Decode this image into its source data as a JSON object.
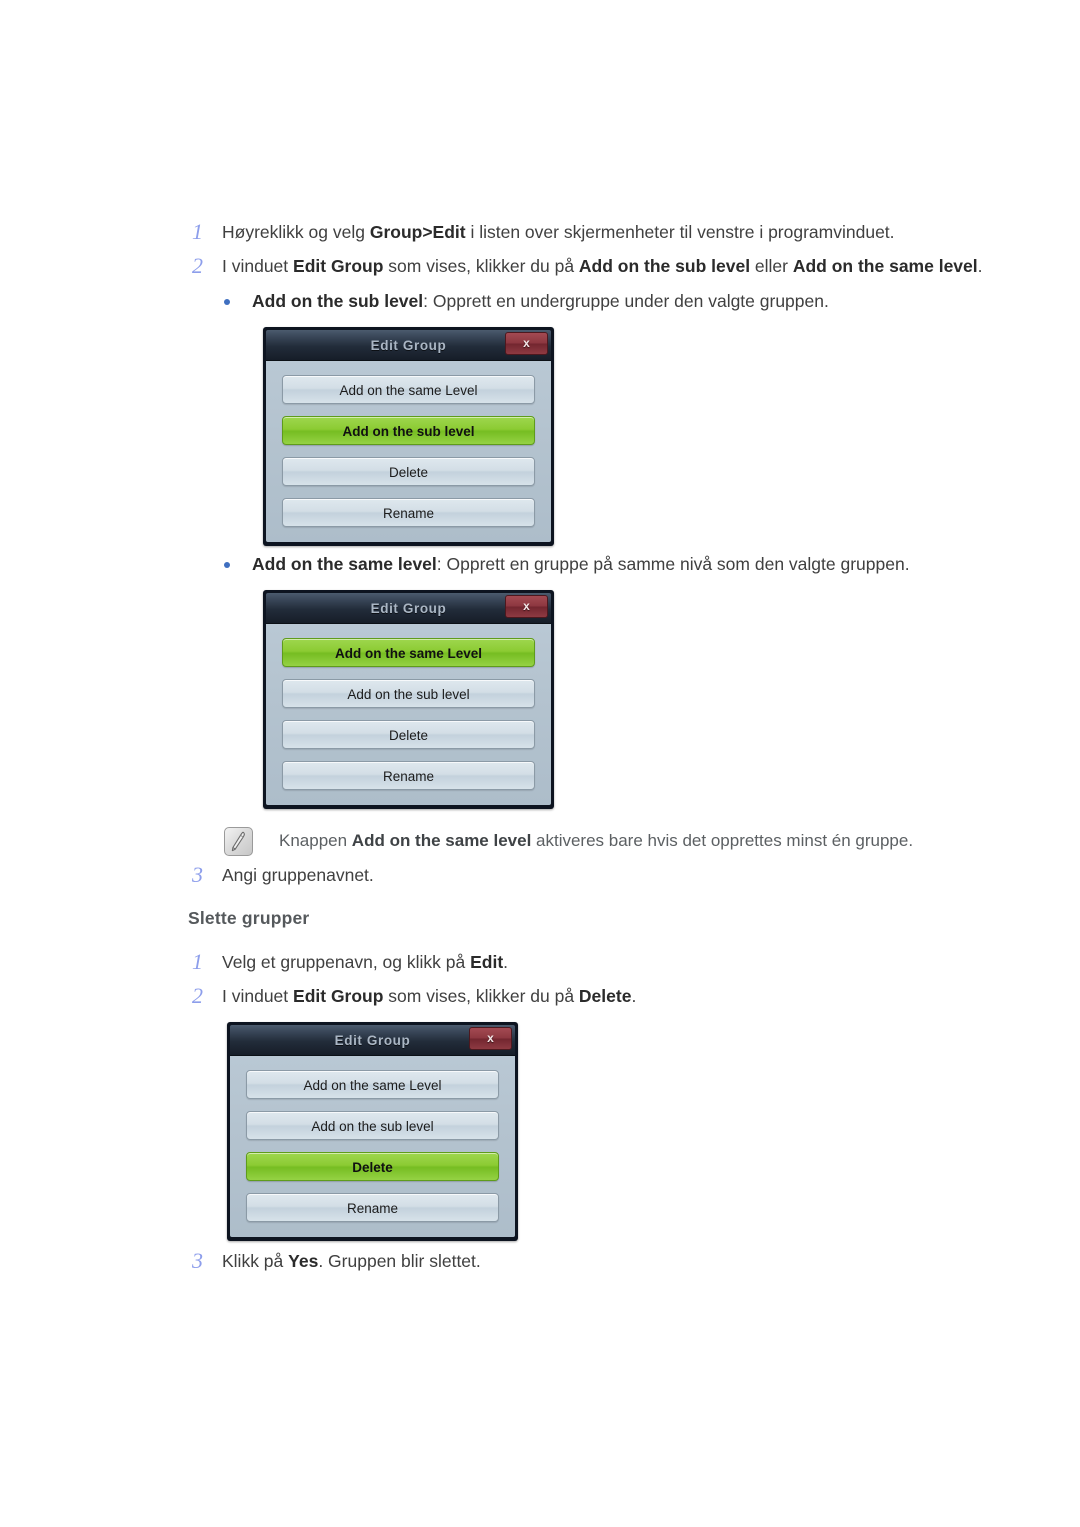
{
  "steps_add": [
    {
      "number": "1",
      "segments": [
        {
          "text": "Høyreklikk og velg ",
          "bold": false
        },
        {
          "text": "Group>Edit",
          "bold": true
        },
        {
          "text": " i listen over skjermenheter til venstre i programvinduet.",
          "bold": false
        }
      ]
    },
    {
      "number": "2",
      "segments": [
        {
          "text": "I vinduet ",
          "bold": false
        },
        {
          "text": "Edit Group",
          "bold": true
        },
        {
          "text": " som vises, klikker du på ",
          "bold": false
        },
        {
          "text": "Add on the sub level",
          "bold": true
        },
        {
          "text": " eller ",
          "bold": false
        },
        {
          "text": "Add on the same level",
          "bold": true
        },
        {
          "text": ".",
          "bold": false
        }
      ]
    },
    {
      "number": "3",
      "segments": [
        {
          "text": "Angi gruppenavnet.",
          "bold": false
        }
      ]
    }
  ],
  "bullets": [
    {
      "segments": [
        {
          "text": "Add on the sub level",
          "bold": true
        },
        {
          "text": ": Opprett en undergruppe under den valgte gruppen.",
          "bold": false
        }
      ]
    },
    {
      "segments": [
        {
          "text": "Add on the same level",
          "bold": true
        },
        {
          "text": ": Opprett en gruppe på samme nivå som den valgte gruppen.",
          "bold": false
        }
      ]
    }
  ],
  "note": {
    "icon": "note-pencil-icon",
    "segments": [
      {
        "text": "Knappen ",
        "bold": false
      },
      {
        "text": "Add on the same level",
        "bold": true
      },
      {
        "text": " aktiveres bare hvis det opprettes minst én gruppe.",
        "bold": false
      }
    ]
  },
  "section_heading": "Slette grupper",
  "steps_delete": [
    {
      "number": "1",
      "segments": [
        {
          "text": "Velg et gruppenavn, og klikk på ",
          "bold": false
        },
        {
          "text": "Edit",
          "bold": true
        },
        {
          "text": ".",
          "bold": false
        }
      ]
    },
    {
      "number": "2",
      "segments": [
        {
          "text": "I vinduet ",
          "bold": false
        },
        {
          "text": "Edit Group",
          "bold": true
        },
        {
          "text": " som vises, klikker du på ",
          "bold": false
        },
        {
          "text": "Delete",
          "bold": true
        },
        {
          "text": ".",
          "bold": false
        }
      ]
    },
    {
      "number": "3",
      "segments": [
        {
          "text": "Klikk på ",
          "bold": false
        },
        {
          "text": "Yes",
          "bold": true
        },
        {
          "text": ". Gruppen blir slettet.",
          "bold": false
        }
      ]
    }
  ],
  "dialogs": [
    {
      "title": "Edit Group",
      "close_label": "x",
      "buttons": [
        {
          "label": "Add on the same Level",
          "highlighted": false
        },
        {
          "label": "Add on the sub level",
          "highlighted": true
        },
        {
          "label": "Delete",
          "highlighted": false
        },
        {
          "label": "Rename",
          "highlighted": false
        }
      ]
    },
    {
      "title": "Edit Group",
      "close_label": "x",
      "buttons": [
        {
          "label": "Add on the same Level",
          "highlighted": true
        },
        {
          "label": "Add on the sub level",
          "highlighted": false
        },
        {
          "label": "Delete",
          "highlighted": false
        },
        {
          "label": "Rename",
          "highlighted": false
        }
      ]
    },
    {
      "title": "Edit Group",
      "close_label": "x",
      "buttons": [
        {
          "label": "Add on the same Level",
          "highlighted": false
        },
        {
          "label": "Add on the sub level",
          "highlighted": false
        },
        {
          "label": "Delete",
          "highlighted": true
        },
        {
          "label": "Rename",
          "highlighted": false
        }
      ]
    }
  ],
  "colors": {
    "step_number": "#8d9eeb",
    "bullet": "#3f6fc0",
    "highlight_green": "#8ccb33",
    "close_red": "#8d3740",
    "titlebar_dark": "#1a2230",
    "dialog_body": "#b4c3cf"
  }
}
